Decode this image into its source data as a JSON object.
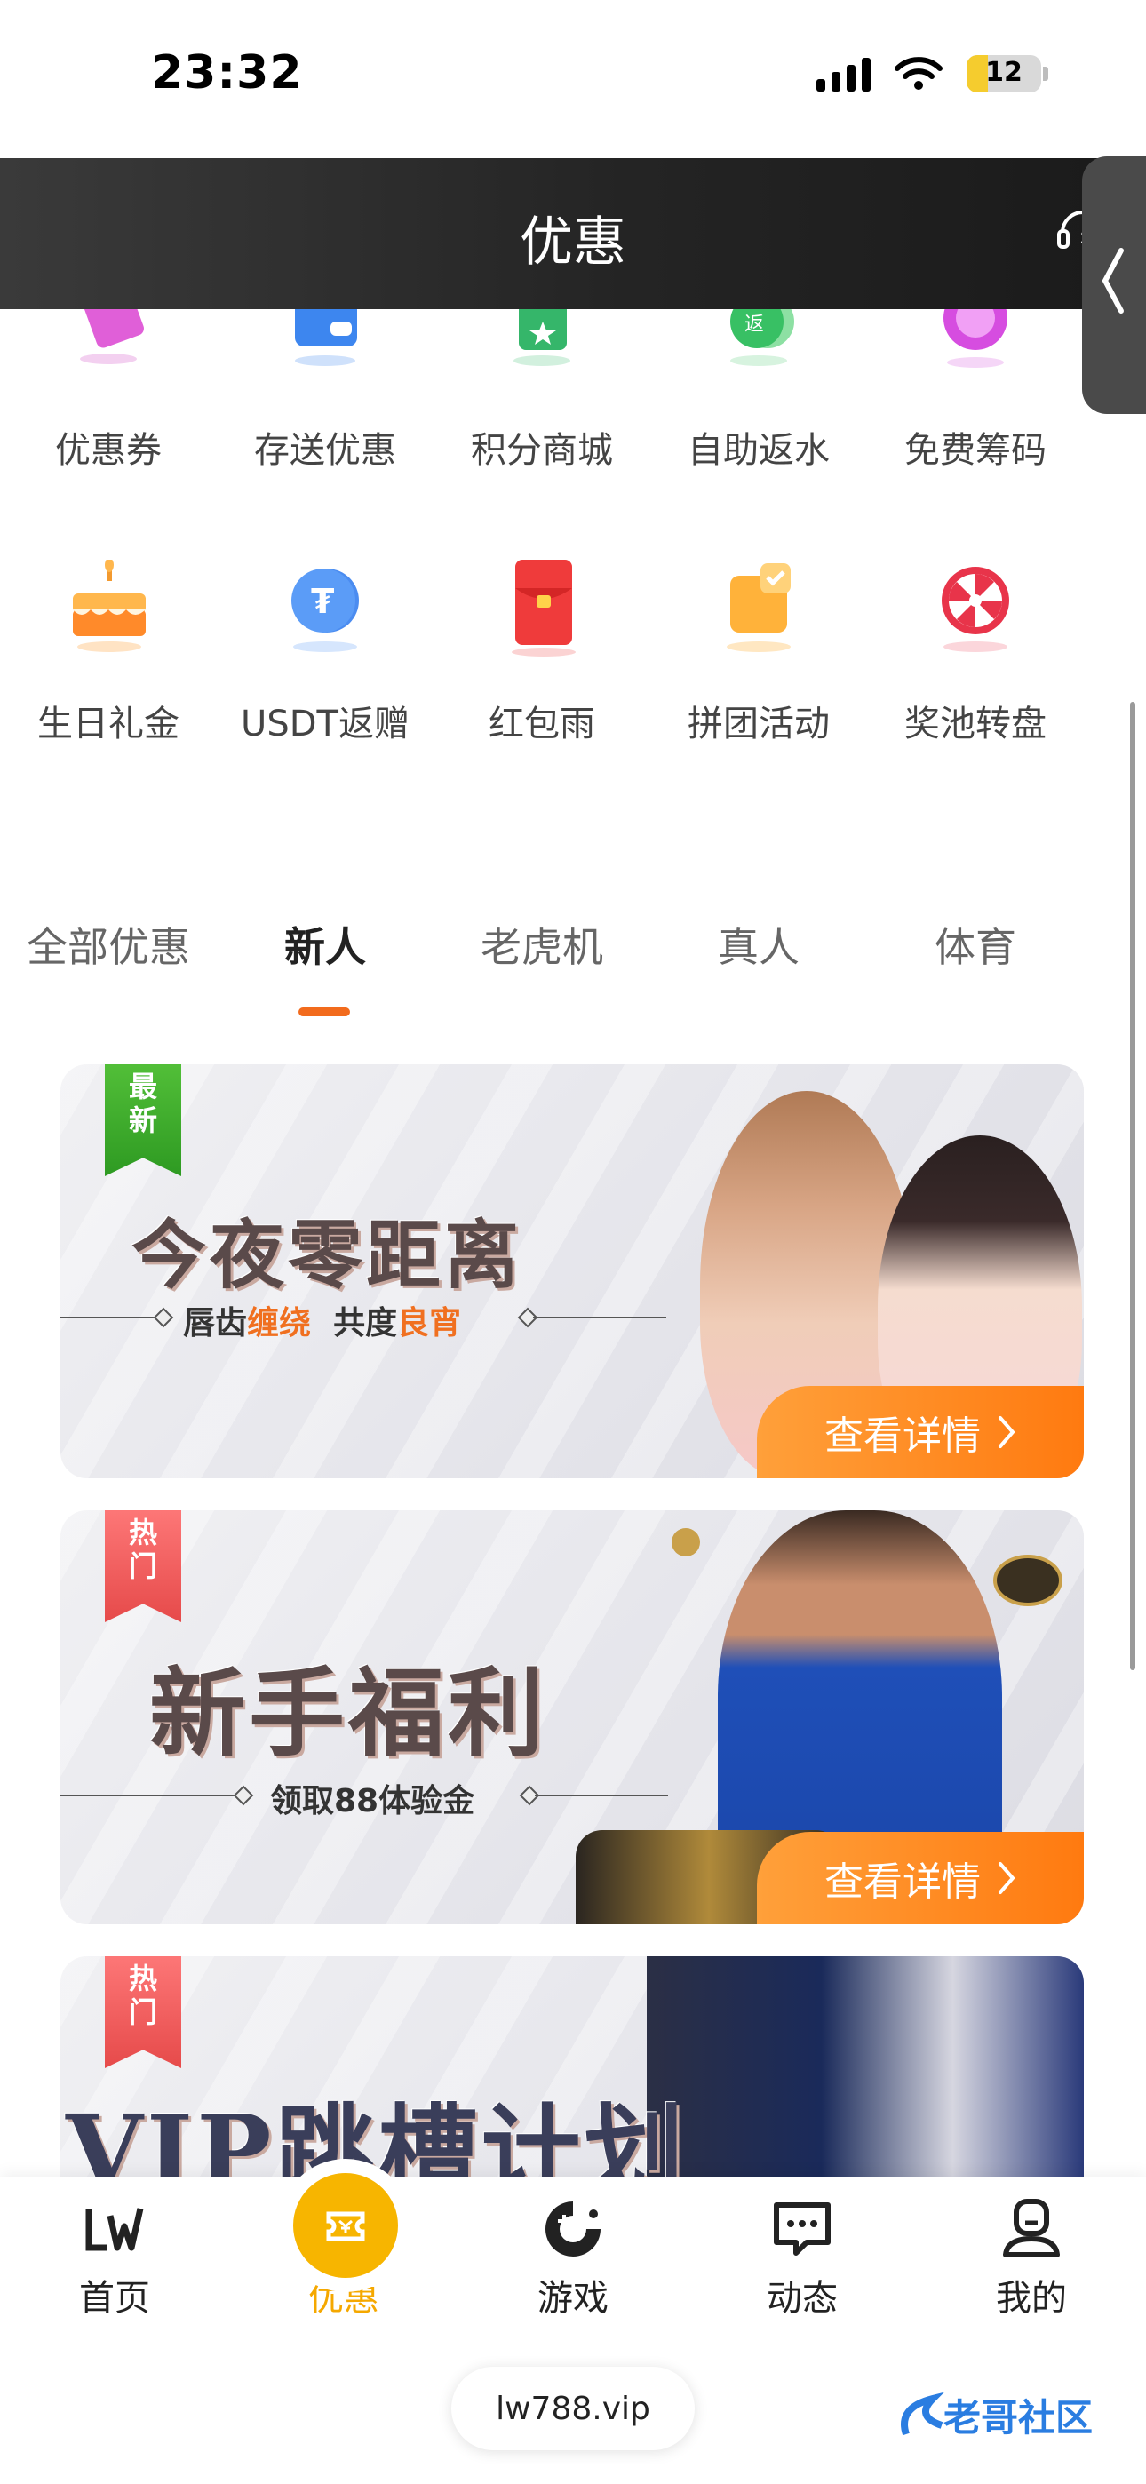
{
  "status": {
    "time": "23:32",
    "battery": "12"
  },
  "header": {
    "title": "优惠"
  },
  "quick_row1": [
    {
      "label": "优惠券",
      "icon": "coupon-icon"
    },
    {
      "label": "存送优惠",
      "icon": "wallet-icon"
    },
    {
      "label": "积分商城",
      "icon": "points-store-icon"
    },
    {
      "label": "自助返水",
      "icon": "rebate-icon"
    },
    {
      "label": "免费筹码",
      "icon": "chip-icon"
    }
  ],
  "quick_row2": [
    {
      "label": "生日礼金",
      "icon": "birthday-cake-icon"
    },
    {
      "label": "USDT返赠",
      "icon": "usdt-icon"
    },
    {
      "label": "红包雨",
      "icon": "red-envelope-icon"
    },
    {
      "label": "拼团活动",
      "icon": "group-buy-icon"
    },
    {
      "label": "奖池转盘",
      "icon": "prize-wheel-icon"
    }
  ],
  "tabs": [
    "全部优惠",
    "新人",
    "老虎机",
    "真人",
    "体育"
  ],
  "active_tab": "新人",
  "banners": [
    {
      "badge": [
        "最",
        "新"
      ],
      "title": "今夜零距离",
      "subtitle_a": "唇齿",
      "subtitle_a_hl": "缠绕",
      "subtitle_b": "共度",
      "subtitle_b_hl": "良宵",
      "button": "查看详情"
    },
    {
      "badge": [
        "热",
        "门"
      ],
      "title": "新手福利",
      "subtitle": "领取88体验金",
      "button": "查看详情"
    },
    {
      "badge": [
        "热",
        "门"
      ],
      "title": "VIP跳槽计划"
    }
  ],
  "bottom_nav": [
    {
      "label": "首页",
      "icon": "lw-logo-icon"
    },
    {
      "label": "优惠",
      "icon": "ticket-icon"
    },
    {
      "label": "游戏",
      "icon": "game-icon"
    },
    {
      "label": "动态",
      "icon": "message-icon"
    },
    {
      "label": "我的",
      "icon": "profile-icon"
    }
  ],
  "url": "lw788.vip",
  "colors": {
    "accent": "#f7b500",
    "orange": "#ff7a10",
    "header": "#2a2a2a"
  }
}
